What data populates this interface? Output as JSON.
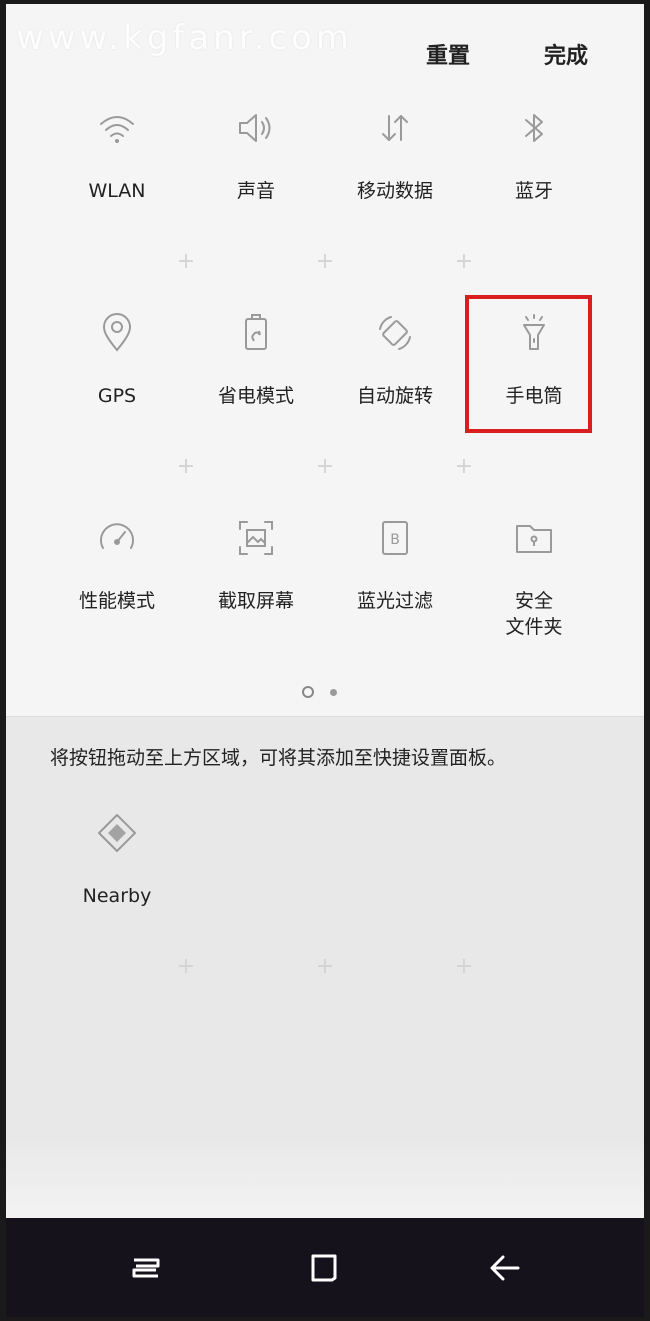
{
  "watermark": "www.kgfanr.com",
  "header": {
    "reset_label": "重置",
    "done_label": "完成"
  },
  "tiles": [
    {
      "label": "WLAN",
      "icon": "wifi-icon"
    },
    {
      "label": "声音",
      "icon": "volume-icon"
    },
    {
      "label": "移动数据",
      "icon": "mobile-data-icon"
    },
    {
      "label": "蓝牙",
      "icon": "bluetooth-icon"
    },
    {
      "label": "GPS",
      "icon": "location-pin-icon"
    },
    {
      "label": "省电模式",
      "icon": "battery-saver-icon"
    },
    {
      "label": "自动旋转",
      "icon": "auto-rotate-icon"
    },
    {
      "label": "手电筒",
      "icon": "flashlight-icon"
    },
    {
      "label": "性能模式",
      "icon": "speedometer-icon"
    },
    {
      "label": "截取屏幕",
      "icon": "screenshot-icon"
    },
    {
      "label": "蓝光过滤",
      "icon": "blue-light-filter-icon"
    },
    {
      "label": "安全\n文件夹",
      "icon": "secure-folder-icon"
    }
  ],
  "pagination": {
    "current": 1,
    "total": 2
  },
  "drawer": {
    "instruction": "将按钮拖动至上方区域，可将其添加至快捷设置面板。",
    "tiles": [
      {
        "label": "Nearby",
        "icon": "nearby-icon"
      }
    ]
  },
  "highlighted_tile": "手电筒",
  "colors": {
    "highlight_border": "#d81e1e",
    "icon_stroke": "#9a9a9a",
    "panel_bg": "#f5f5f5",
    "drawer_bg": "#e8e8e8",
    "navbar_bg": "#16121c"
  },
  "navbar": {
    "icons": [
      "recent-apps-icon",
      "home-icon",
      "back-icon"
    ]
  }
}
